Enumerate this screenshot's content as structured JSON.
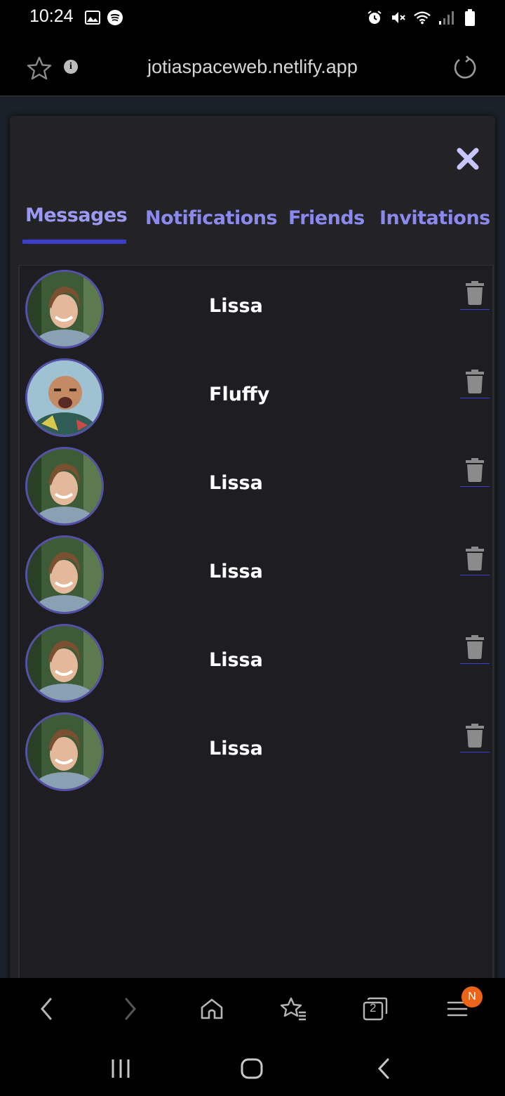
{
  "status_bar": {
    "time": "10:24",
    "left_icons": [
      "image-icon",
      "spotify-icon"
    ],
    "right_icons": [
      "alarm-icon",
      "mute-icon",
      "wifi-icon",
      "signal-icon",
      "battery-icon"
    ]
  },
  "browser": {
    "url": "jotiaspaceweb.netlify.app"
  },
  "panel": {
    "tabs": [
      {
        "label": "Messages",
        "active": true
      },
      {
        "label": "Notifications",
        "active": false
      },
      {
        "label": "Friends",
        "active": false
      },
      {
        "label": "Invitations",
        "active": false
      }
    ],
    "messages": [
      {
        "name": "Lissa",
        "avatar": "woman-avatar"
      },
      {
        "name": "Fluffy",
        "avatar": "man-avatar"
      },
      {
        "name": "Lissa",
        "avatar": "woman-avatar"
      },
      {
        "name": "Lissa",
        "avatar": "woman-avatar"
      },
      {
        "name": "Lissa",
        "avatar": "woman-avatar"
      },
      {
        "name": "Lissa",
        "avatar": "woman-avatar"
      }
    ]
  },
  "toolbar": {
    "tabs_count": "2",
    "menu_badge": "N"
  },
  "colors": {
    "accent": "#3d3bd1",
    "tab_text": "#8a89ef",
    "panel_bg": "#232325",
    "badge": "#ec6418"
  }
}
